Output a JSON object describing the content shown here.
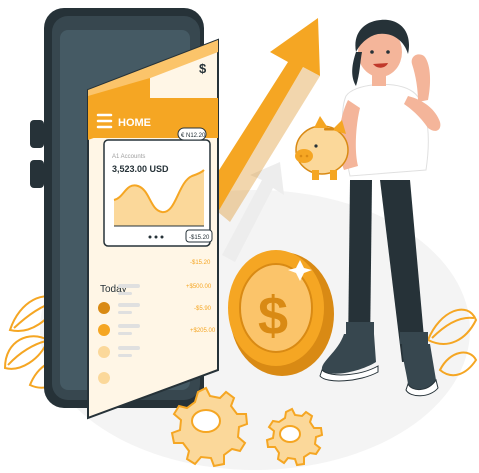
{
  "colors": {
    "accent": "#F5A623",
    "accent_light": "#FBC46A",
    "accent_dark": "#D98A14",
    "phone_body": "#37474F",
    "screen_bg": "#FFF6E6",
    "header_bg": "#F5A623",
    "dark_text": "#263238",
    "gray": "#E0E0E0",
    "muted": "#9E9E9E"
  },
  "phone": {
    "currency_symbol": "$",
    "header_title": "HOME",
    "card": {
      "caption": "A1 Accounts",
      "balance": "3,523.00 USD",
      "badge": "€ N12.20",
      "tag": "-$15.20"
    },
    "today_label": "Today",
    "transactions": [
      {
        "amount": "-$15.20"
      },
      {
        "amount": "+$500.00"
      },
      {
        "amount": "-$5.90"
      },
      {
        "amount": "+$205.00"
      }
    ]
  },
  "coin": {
    "symbol": "$"
  }
}
